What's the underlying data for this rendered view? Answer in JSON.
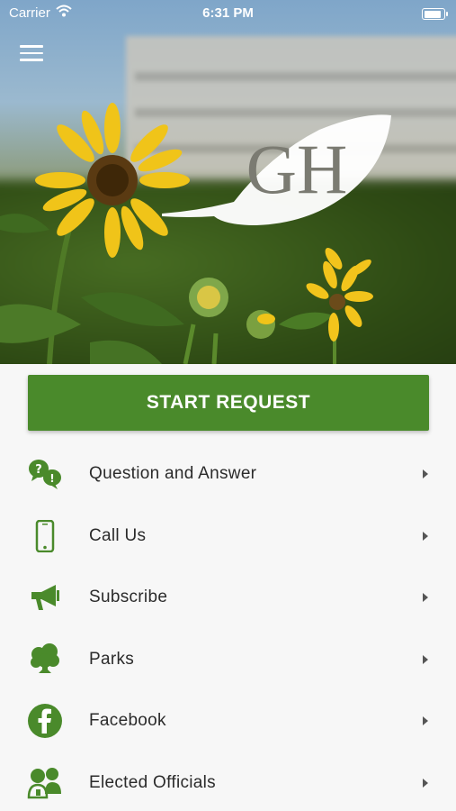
{
  "status_bar": {
    "carrier": "Carrier",
    "time": "6:31 PM",
    "battery_level": 1.0
  },
  "hero": {
    "logo_text": "GH"
  },
  "request": {
    "label": "START REQUEST"
  },
  "menu": [
    {
      "label": "Question and Answer",
      "icon": "question-bubbles-icon"
    },
    {
      "label": "Call Us",
      "icon": "phone-icon"
    },
    {
      "label": "Subscribe",
      "icon": "megaphone-icon"
    },
    {
      "label": "Parks",
      "icon": "tree-icon"
    },
    {
      "label": "Facebook",
      "icon": "facebook-icon"
    },
    {
      "label": "Elected Officials",
      "icon": "officials-icon"
    }
  ],
  "colors": {
    "accent": "#4a8a2b",
    "text": "#2b2b2b",
    "background": "#f7f7f7"
  }
}
